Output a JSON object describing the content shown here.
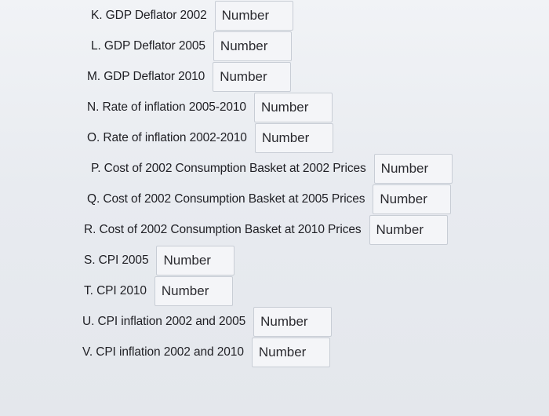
{
  "placeholder": "Number",
  "questions": [
    {
      "label": "K. GDP Deflator 2002"
    },
    {
      "label": "L. GDP Deflator 2005"
    },
    {
      "label": "M. GDP Deflator 2010"
    },
    {
      "label": "N. Rate of inflation 2005-2010"
    },
    {
      "label": "O. Rate of inflation 2002-2010"
    },
    {
      "label": "P. Cost of 2002 Consumption Basket at 2002 Prices"
    },
    {
      "label": "Q. Cost of 2002 Consumption Basket at 2005 Prices"
    },
    {
      "label": "R. Cost of 2002 Consumption Basket at 2010 Prices"
    },
    {
      "label": "S. CPI 2005"
    },
    {
      "label": "T. CPI 2010"
    },
    {
      "label": "U. CPI inflation 2002 and 2005"
    },
    {
      "label": "V. CPI inflation 2002 and 2010"
    }
  ]
}
